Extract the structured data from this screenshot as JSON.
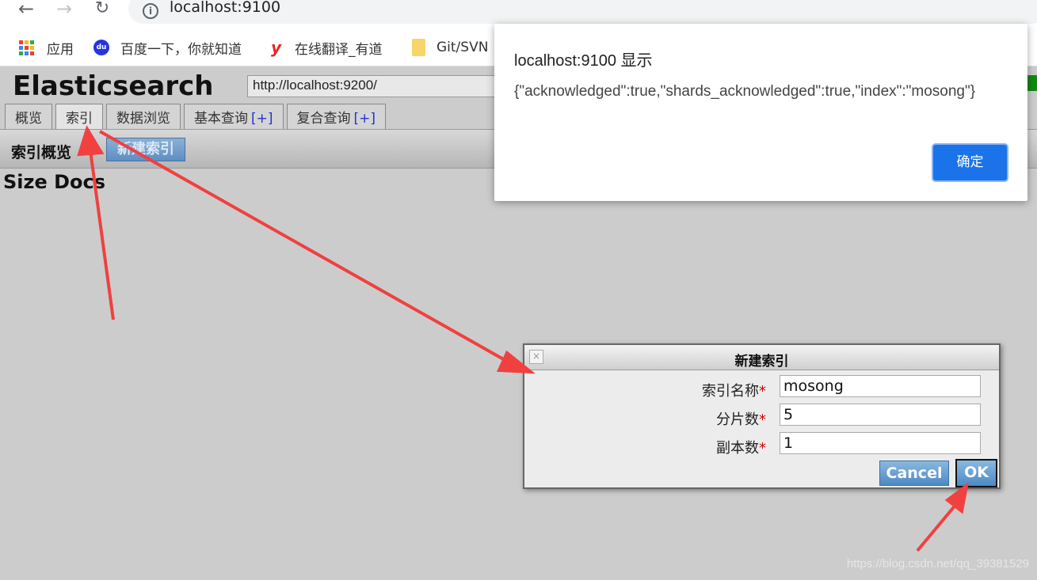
{
  "browser": {
    "url": "localhost:9100",
    "bookmarks": [
      {
        "label": "应用",
        "icon": "apps-grid-icon"
      },
      {
        "label": "百度一下，你就知道",
        "icon": "baidu-icon"
      },
      {
        "label": "在线翻译_有道",
        "icon": "youdao-icon"
      },
      {
        "label": "Git/SVN",
        "icon": "folder-icon"
      }
    ]
  },
  "es": {
    "title": "Elasticsearch",
    "cluster_url": "http://localhost:9200/",
    "tabs": [
      {
        "label": "概览"
      },
      {
        "label": "索引"
      },
      {
        "label": "数据浏览"
      },
      {
        "label": "基本查询",
        "plus": "[+]"
      },
      {
        "label": "复合查询",
        "plus": "[+]"
      }
    ],
    "sub_title": "索引概览",
    "new_index_button": "新建索引",
    "size_docs": "Size Docs"
  },
  "dialog": {
    "title": "新建索引",
    "fields": [
      {
        "label": "索引名称",
        "required": "*",
        "value": "mosong"
      },
      {
        "label": "分片数",
        "required": "*",
        "value": "5"
      },
      {
        "label": "副本数",
        "required": "*",
        "value": "1"
      }
    ],
    "cancel_label": "Cancel",
    "ok_label": "OK"
  },
  "alert": {
    "title": "localhost:9100 显示",
    "message": "{\"acknowledged\":true,\"shards_acknowledged\":true,\"index\":\"mosong\"}",
    "ok_label": "确定"
  },
  "watermark": "https://blog.csdn.net/qq_39381529",
  "colors": {
    "annotation_arrow": "#f04040",
    "page_background": "#cccccc",
    "alert_button": "#1a73e8",
    "status_green": "#118811"
  }
}
